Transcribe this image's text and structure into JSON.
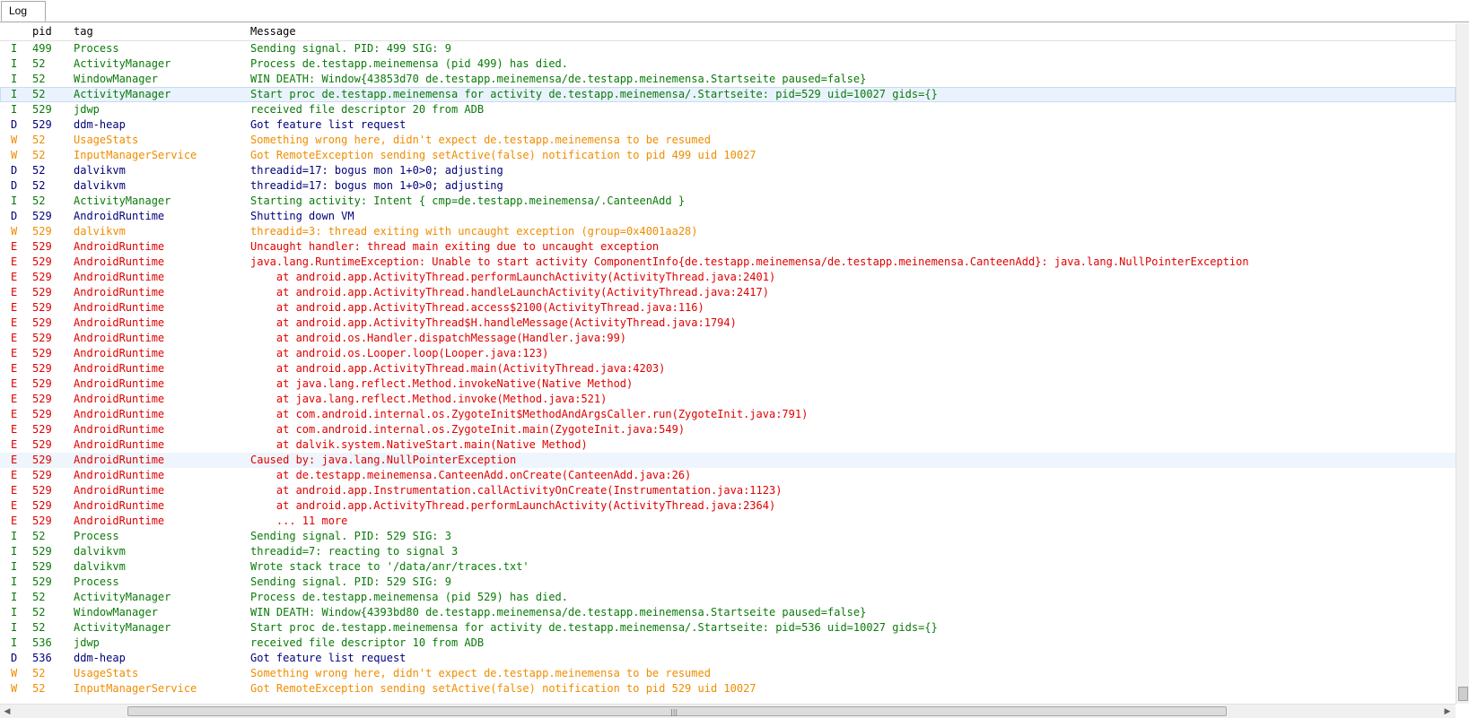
{
  "tab": {
    "label": "Log"
  },
  "columns": {
    "level": "",
    "pid": "pid",
    "tag": "tag",
    "message": "Message"
  },
  "colors": {
    "I": "#0a7a0a",
    "D": "#00007a",
    "W": "#f08c00",
    "E": "#e00000"
  },
  "rows": [
    {
      "lvl": "I",
      "pid": "499",
      "tag": "Process",
      "msg": "Sending signal. PID: 499 SIG: 9"
    },
    {
      "lvl": "I",
      "pid": "52",
      "tag": "ActivityManager",
      "msg": "Process de.testapp.meinemensa (pid 499) has died."
    },
    {
      "lvl": "I",
      "pid": "52",
      "tag": "WindowManager",
      "msg": "WIN DEATH: Window{43853d70 de.testapp.meinemensa/de.testapp.meinemensa.Startseite paused=false}"
    },
    {
      "lvl": "I",
      "pid": "52",
      "tag": "ActivityManager",
      "msg": "Start proc de.testapp.meinemensa for activity de.testapp.meinemensa/.Startseite: pid=529 uid=10027 gids={}",
      "selected": true
    },
    {
      "lvl": "I",
      "pid": "529",
      "tag": "jdwp",
      "msg": "received file descriptor 20 from ADB"
    },
    {
      "lvl": "D",
      "pid": "529",
      "tag": "ddm-heap",
      "msg": "Got feature list request"
    },
    {
      "lvl": "W",
      "pid": "52",
      "tag": "UsageStats",
      "msg": "Something wrong here, didn't expect de.testapp.meinemensa to be resumed"
    },
    {
      "lvl": "W",
      "pid": "52",
      "tag": "InputManagerService",
      "msg": "Got RemoteException sending setActive(false) notification to pid 499 uid 10027"
    },
    {
      "lvl": "D",
      "pid": "52",
      "tag": "dalvikvm",
      "msg": "threadid=17: bogus mon 1+0>0; adjusting"
    },
    {
      "lvl": "D",
      "pid": "52",
      "tag": "dalvikvm",
      "msg": "threadid=17: bogus mon 1+0>0; adjusting"
    },
    {
      "lvl": "I",
      "pid": "52",
      "tag": "ActivityManager",
      "msg": "Starting activity: Intent { cmp=de.testapp.meinemensa/.CanteenAdd }"
    },
    {
      "lvl": "D",
      "pid": "529",
      "tag": "AndroidRuntime",
      "msg": "Shutting down VM"
    },
    {
      "lvl": "W",
      "pid": "529",
      "tag": "dalvikvm",
      "msg": "threadid=3: thread exiting with uncaught exception (group=0x4001aa28)"
    },
    {
      "lvl": "E",
      "pid": "529",
      "tag": "AndroidRuntime",
      "msg": "Uncaught handler: thread main exiting due to uncaught exception"
    },
    {
      "lvl": "E",
      "pid": "529",
      "tag": "AndroidRuntime",
      "msg": "java.lang.RuntimeException: Unable to start activity ComponentInfo{de.testapp.meinemensa/de.testapp.meinemensa.CanteenAdd}: java.lang.NullPointerException"
    },
    {
      "lvl": "E",
      "pid": "529",
      "tag": "AndroidRuntime",
      "msg": "    at android.app.ActivityThread.performLaunchActivity(ActivityThread.java:2401)"
    },
    {
      "lvl": "E",
      "pid": "529",
      "tag": "AndroidRuntime",
      "msg": "    at android.app.ActivityThread.handleLaunchActivity(ActivityThread.java:2417)"
    },
    {
      "lvl": "E",
      "pid": "529",
      "tag": "AndroidRuntime",
      "msg": "    at android.app.ActivityThread.access$2100(ActivityThread.java:116)"
    },
    {
      "lvl": "E",
      "pid": "529",
      "tag": "AndroidRuntime",
      "msg": "    at android.app.ActivityThread$H.handleMessage(ActivityThread.java:1794)"
    },
    {
      "lvl": "E",
      "pid": "529",
      "tag": "AndroidRuntime",
      "msg": "    at android.os.Handler.dispatchMessage(Handler.java:99)"
    },
    {
      "lvl": "E",
      "pid": "529",
      "tag": "AndroidRuntime",
      "msg": "    at android.os.Looper.loop(Looper.java:123)"
    },
    {
      "lvl": "E",
      "pid": "529",
      "tag": "AndroidRuntime",
      "msg": "    at android.app.ActivityThread.main(ActivityThread.java:4203)"
    },
    {
      "lvl": "E",
      "pid": "529",
      "tag": "AndroidRuntime",
      "msg": "    at java.lang.reflect.Method.invokeNative(Native Method)"
    },
    {
      "lvl": "E",
      "pid": "529",
      "tag": "AndroidRuntime",
      "msg": "    at java.lang.reflect.Method.invoke(Method.java:521)"
    },
    {
      "lvl": "E",
      "pid": "529",
      "tag": "AndroidRuntime",
      "msg": "    at com.android.internal.os.ZygoteInit$MethodAndArgsCaller.run(ZygoteInit.java:791)"
    },
    {
      "lvl": "E",
      "pid": "529",
      "tag": "AndroidRuntime",
      "msg": "    at com.android.internal.os.ZygoteInit.main(ZygoteInit.java:549)"
    },
    {
      "lvl": "E",
      "pid": "529",
      "tag": "AndroidRuntime",
      "msg": "    at dalvik.system.NativeStart.main(Native Method)"
    },
    {
      "lvl": "E",
      "pid": "529",
      "tag": "AndroidRuntime",
      "msg": "Caused by: java.lang.NullPointerException",
      "hover": true
    },
    {
      "lvl": "E",
      "pid": "529",
      "tag": "AndroidRuntime",
      "msg": "    at de.testapp.meinemensa.CanteenAdd.onCreate(CanteenAdd.java:26)"
    },
    {
      "lvl": "E",
      "pid": "529",
      "tag": "AndroidRuntime",
      "msg": "    at android.app.Instrumentation.callActivityOnCreate(Instrumentation.java:1123)"
    },
    {
      "lvl": "E",
      "pid": "529",
      "tag": "AndroidRuntime",
      "msg": "    at android.app.ActivityThread.performLaunchActivity(ActivityThread.java:2364)"
    },
    {
      "lvl": "E",
      "pid": "529",
      "tag": "AndroidRuntime",
      "msg": "    ... 11 more"
    },
    {
      "lvl": "I",
      "pid": "52",
      "tag": "Process",
      "msg": "Sending signal. PID: 529 SIG: 3"
    },
    {
      "lvl": "I",
      "pid": "529",
      "tag": "dalvikvm",
      "msg": "threadid=7: reacting to signal 3"
    },
    {
      "lvl": "I",
      "pid": "529",
      "tag": "dalvikvm",
      "msg": "Wrote stack trace to '/data/anr/traces.txt'"
    },
    {
      "lvl": "I",
      "pid": "529",
      "tag": "Process",
      "msg": "Sending signal. PID: 529 SIG: 9"
    },
    {
      "lvl": "I",
      "pid": "52",
      "tag": "ActivityManager",
      "msg": "Process de.testapp.meinemensa (pid 529) has died."
    },
    {
      "lvl": "I",
      "pid": "52",
      "tag": "WindowManager",
      "msg": "WIN DEATH: Window{4393bd80 de.testapp.meinemensa/de.testapp.meinemensa.Startseite paused=false}"
    },
    {
      "lvl": "I",
      "pid": "52",
      "tag": "ActivityManager",
      "msg": "Start proc de.testapp.meinemensa for activity de.testapp.meinemensa/.Startseite: pid=536 uid=10027 gids={}"
    },
    {
      "lvl": "I",
      "pid": "536",
      "tag": "jdwp",
      "msg": "received file descriptor 10 from ADB"
    },
    {
      "lvl": "D",
      "pid": "536",
      "tag": "ddm-heap",
      "msg": "Got feature list request"
    },
    {
      "lvl": "W",
      "pid": "52",
      "tag": "UsageStats",
      "msg": "Something wrong here, didn't expect de.testapp.meinemensa to be resumed"
    },
    {
      "lvl": "W",
      "pid": "52",
      "tag": "InputManagerService",
      "msg": "Got RemoteException sending setActive(false) notification to pid 529 uid 10027"
    }
  ],
  "scrollbar": {
    "grip_glyph": "|||",
    "left_arrow": "◀",
    "right_arrow": "▶"
  }
}
